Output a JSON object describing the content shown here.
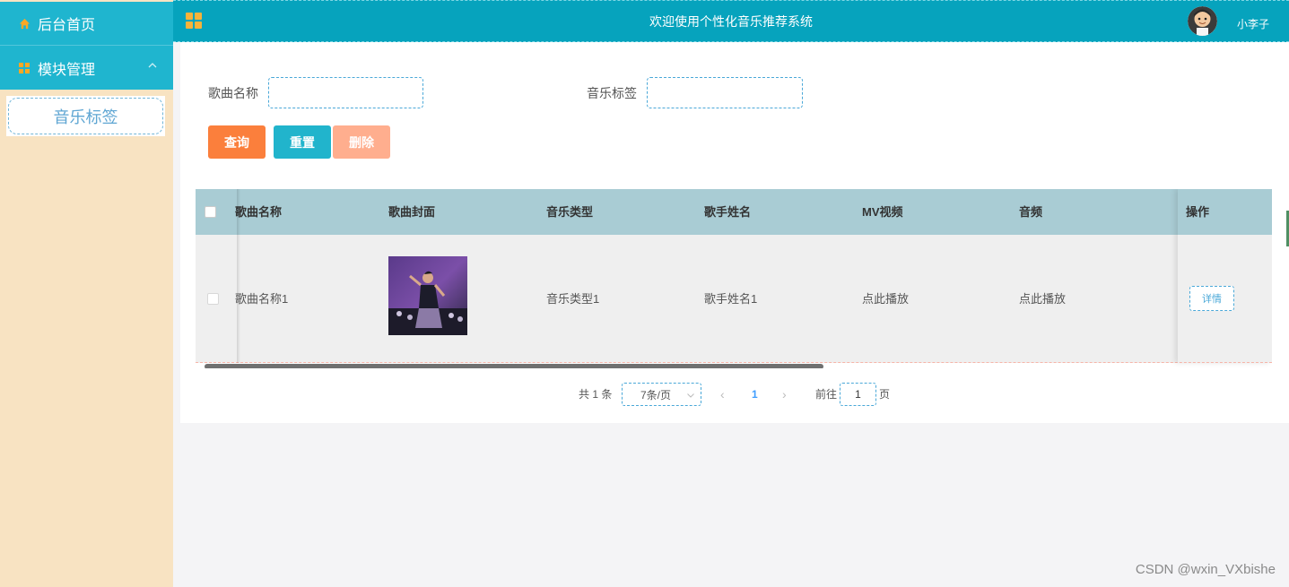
{
  "sidebar": {
    "home_label": "后台首页",
    "module_label": "模块管理",
    "submenu_label": "音乐标签"
  },
  "header": {
    "title": "欢迎使用个性化音乐推荐系统",
    "username": "小李子"
  },
  "search": {
    "song_name_label": "歌曲名称",
    "song_name_value": "",
    "tag_label": "音乐标签",
    "tag_value": ""
  },
  "buttons": {
    "query": "查询",
    "reset": "重置",
    "delete": "删除"
  },
  "table": {
    "columns": [
      "歌曲名称",
      "歌曲封面",
      "音乐类型",
      "歌手姓名",
      "MV视频",
      "音频",
      "操作"
    ],
    "rows": [
      {
        "song_name": "歌曲名称1",
        "music_type": "音乐类型1",
        "singer": "歌手姓名1",
        "mv": "点此播放",
        "audio": "点此播放",
        "action": "详情"
      }
    ]
  },
  "pagination": {
    "total": "共 1 条",
    "page_size": "7条/页",
    "current_page": "1",
    "goto_label": "前往",
    "goto_value": "1",
    "page_unit": "页"
  },
  "watermark": "CSDN @wxin_VXbishe"
}
